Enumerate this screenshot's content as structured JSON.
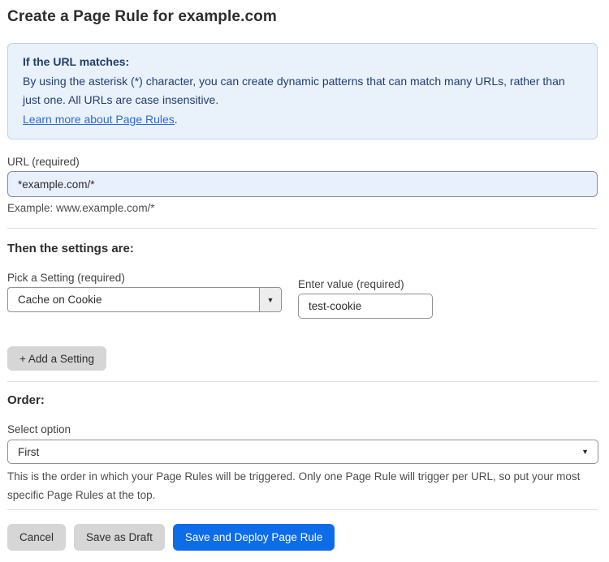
{
  "page": {
    "title": "Create a Page Rule for example.com"
  },
  "info_box": {
    "heading": "If the URL matches:",
    "body": "By using the asterisk (*) character, you can create dynamic patterns that can match many URLs, rather than just one. All URLs are case insensitive.",
    "link_label": "Learn more about Page Rules",
    "link_suffix": "."
  },
  "url_field": {
    "label": "URL (required)",
    "value": "*example.com/*",
    "helper": "Example: www.example.com/*"
  },
  "settings_section": {
    "heading": "Then the settings are:",
    "setting_select": {
      "label": "Pick a Setting (required)",
      "value": "Cache on Cookie"
    },
    "value_field": {
      "label": "Enter value (required)",
      "value": "test-cookie"
    },
    "add_setting_label": "+ Add a Setting"
  },
  "order_section": {
    "heading": "Order:",
    "select_label": "Select option",
    "selected_option": "First",
    "helper": "This is the order in which your Page Rules will be triggered. Only one Page Rule will trigger per URL, so put your most specific Page Rules at the top."
  },
  "footer": {
    "cancel_label": "Cancel",
    "save_draft_label": "Save as Draft",
    "save_deploy_label": "Save and Deploy Page Rule"
  },
  "icons": {
    "dropdown_arrow": "▼"
  },
  "colors": {
    "accent_blue": "#0d6ce8",
    "info_background": "#e9f1fb",
    "info_border": "#b9d5f1",
    "info_text": "#1f3e70",
    "link_blue": "#2e6bd4",
    "url_input_background": "#e8f0fe",
    "button_gray": "#d6d6d6"
  }
}
